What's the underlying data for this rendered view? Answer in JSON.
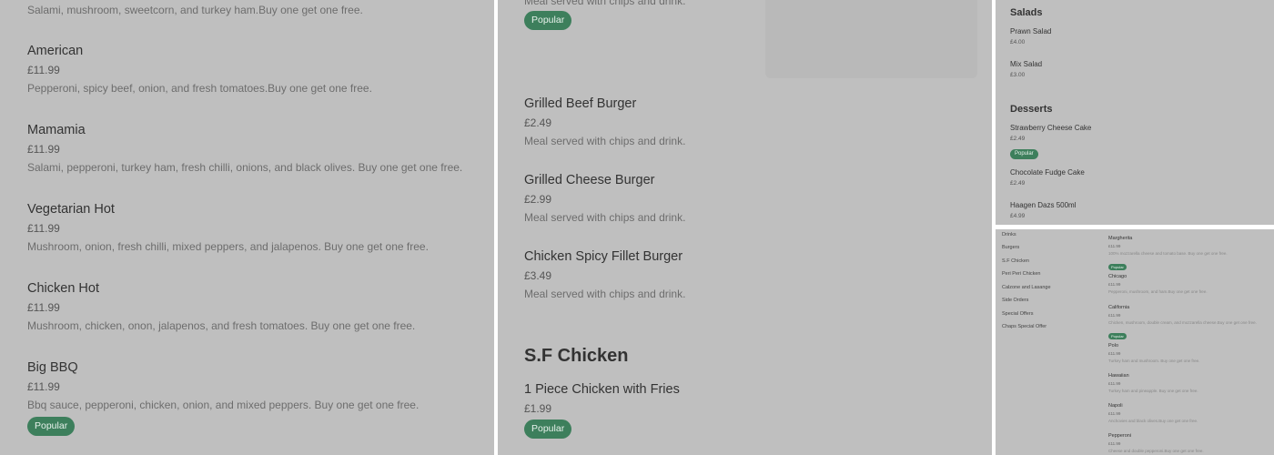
{
  "panel1": {
    "top_desc": "Salami, mushroom, sweetcorn, and turkey ham.Buy one get one free.",
    "items": [
      {
        "name": "American",
        "price": "£11.99",
        "desc": "Pepperoni, spicy beef, onion, and fresh tomatoes.Buy one get one free."
      },
      {
        "name": "Mamamia",
        "price": "£11.99",
        "desc": "Salami, pepperoni, turkey ham, fresh chilli, onions, and black olives. Buy one get one free."
      },
      {
        "name": "Vegetarian Hot",
        "price": "£11.99",
        "desc": "Mushroom, onion, fresh chilli, mixed peppers, and jalapenos. Buy one get one free."
      },
      {
        "name": "Chicken Hot",
        "price": "£11.99",
        "desc": "Mushroom, chicken, onon, jalapenos, and fresh tomatoes. Buy one get one free."
      },
      {
        "name": "Big BBQ",
        "price": "£11.99",
        "desc": "Bbq sauce, pepperoni, chicken, onion, and mixed peppers. Buy one get one free.",
        "badge": "Popular"
      }
    ]
  },
  "panel2": {
    "top_desc": "Meal served with chips and drink.",
    "top_badge": "Popular",
    "items": [
      {
        "name": "Grilled Beef Burger",
        "price": "£2.49",
        "desc": "Meal served with chips and drink."
      },
      {
        "name": "Grilled Cheese Burger",
        "price": "£2.99",
        "desc": "Meal served with chips and drink."
      },
      {
        "name": "Chicken Spicy Fillet Burger",
        "price": "£3.49",
        "desc": "Meal served with chips and drink."
      }
    ],
    "section_title": "S.F Chicken",
    "section_item": {
      "name": "1 Piece Chicken with Fries",
      "price": "£1.99",
      "badge": "Popular"
    }
  },
  "panel3": {
    "salads_title": "Salads",
    "salads": [
      {
        "name": "Prawn Salad",
        "price": "£4.00"
      },
      {
        "name": "Mix Salad",
        "price": "£3.00"
      }
    ],
    "desserts_title": "Desserts",
    "desserts": [
      {
        "name": "Strawberry Cheese Cake",
        "price": "£2.49",
        "badge": "Popular"
      },
      {
        "name": "Chocolate Fudge Cake",
        "price": "£2.49"
      },
      {
        "name": "Haagen Dazs 500ml",
        "price": "£4.99"
      }
    ]
  },
  "panel4": {
    "categories": [
      "Drinks",
      "Burgers",
      "S.F Chicken",
      "Peri Peri Chicken",
      "Calzone and Lasange",
      "Side Orders",
      "Special Offers",
      "Chaps Special Offer"
    ],
    "items": [
      {
        "name": "Margherita",
        "price": "£11.99",
        "desc": "100% mozzarella cheese and tomato base. Buy one get one free.",
        "badge": "Popular"
      },
      {
        "name": "Chicago",
        "price": "£11.99",
        "desc": "Pepperoni, mushroom, and ham.Buy one get one free."
      },
      {
        "name": "California",
        "price": "£11.99",
        "desc": "Chicken, mushroom, double cream, and mozzarella cheese.Buy one get one free.",
        "badge": "Popular"
      },
      {
        "name": "Polo",
        "price": "£11.99",
        "desc": "Turkey ham and mushroom. Buy one get one free."
      },
      {
        "name": "Hawaiian",
        "price": "£11.99",
        "desc": "Turkey ham and pineapple. Buy one get one free."
      },
      {
        "name": "Napoli",
        "price": "£11.99",
        "desc": "Anchovies and black olives.Buy one get one free."
      },
      {
        "name": "Pepperoni",
        "price": "£11.99",
        "desc": "Cheese and double pepperoni.Buy one get one free."
      }
    ]
  }
}
